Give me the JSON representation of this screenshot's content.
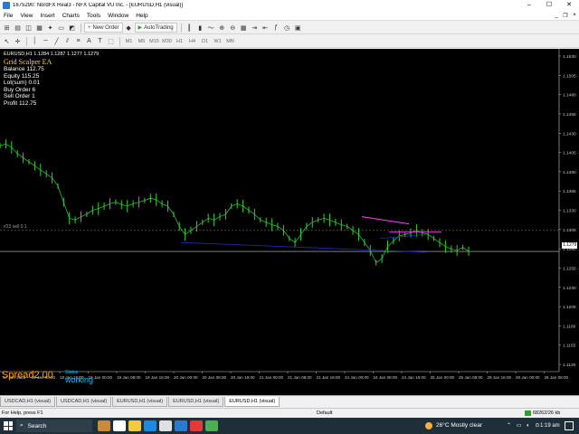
{
  "window": {
    "title": "1675290: NordFX Real3 - NFX Capital VU Inc. - [EURUSD,H1 (visual)]",
    "minimize": "–",
    "maximize": "☐",
    "close": "✕"
  },
  "menu": [
    "File",
    "View",
    "Insert",
    "Charts",
    "Tools",
    "Window",
    "Help"
  ],
  "toolbar": {
    "new_order": "New Order",
    "autotrading": "AutoTrading",
    "timeframes": [
      "M1",
      "M5",
      "M15",
      "M30",
      "H1",
      "H4",
      "D1",
      "W1",
      "MN"
    ]
  },
  "chart": {
    "symbol_label": "EURUSD,H1  1.1284 1.1287 1.1277 1.1279",
    "ea_name": "Grid Scalper EA",
    "stats": [
      {
        "label": "Balance",
        "value": "112.75"
      },
      {
        "label": "Equity",
        "value": "115.25"
      },
      {
        "label": "Lot(sum)",
        "value": "0.01"
      },
      {
        "label": "Buy Order",
        "value": "6"
      },
      {
        "label": "Sell Order",
        "value": "1"
      },
      {
        "label": "Profit",
        "value": "112.75"
      }
    ],
    "level_label": "#23 sell 0.1",
    "current_price": "1.1279",
    "spread_label": "Spread",
    "spread_value": "2.00",
    "status_label": "Status",
    "status_value": "working",
    "colors": {
      "candles": "#33cc33",
      "spread": "#ffa500",
      "status": "#00bfff",
      "trend_line": "#ff44ff"
    }
  },
  "chart_data": {
    "type": "line",
    "symbol": "EURUSD",
    "timeframe": "H1",
    "y_ticks": [
      "1.1530",
      "1.1505",
      "1.1480",
      "1.1455",
      "1.1430",
      "1.1405",
      "1.1380",
      "1.1355",
      "1.1330",
      "1.1305",
      "1.1280",
      "1.1255",
      "1.1230",
      "1.1205",
      "1.1180",
      "1.1155",
      "1.1130"
    ],
    "x_ticks": [
      "17 Jan 2022",
      "18 Jan 08:00",
      "18 Jan 16:00",
      "19 Jan 00:00",
      "19 Jan 08:00",
      "19 Jan 16:00",
      "20 Jan 00:00",
      "20 Jan 08:00",
      "20 Jan 16:00",
      "21 Jan 00:00",
      "21 Jan 08:00",
      "21 Jan 16:00",
      "24 Jan 00:00",
      "24 Jan 08:00",
      "24 Jan 16:00",
      "25 Jan 00:00",
      "25 Jan 08:00",
      "25 Jan 16:00",
      "26 Jan 00:00",
      "26 Jan 08:00"
    ],
    "ylim": [
      1.113,
      1.153
    ],
    "price_path": [
      1.141,
      1.1412,
      1.1408,
      1.14,
      1.1395,
      1.139,
      1.1385,
      1.138,
      1.1375,
      1.137,
      1.136,
      1.134,
      1.132,
      1.1318,
      1.1322,
      1.1325,
      1.133,
      1.1332,
      1.1335,
      1.1338,
      1.134,
      1.1337,
      1.1335,
      1.1338,
      1.134,
      1.1342,
      1.1345,
      1.1343,
      1.1338,
      1.1335,
      1.1325,
      1.131,
      1.13,
      1.1305,
      1.131,
      1.1315,
      1.132,
      1.1318,
      1.1322,
      1.1325,
      1.1335,
      1.1338,
      1.1335,
      1.133,
      1.1325,
      1.1318,
      1.1315,
      1.1312,
      1.131,
      1.1305,
      1.1295,
      1.129,
      1.13,
      1.131,
      1.1315,
      1.1318,
      1.132,
      1.1318,
      1.1315,
      1.1312,
      1.131,
      1.1305,
      1.13,
      1.129,
      1.128,
      1.1265,
      1.127,
      1.1285,
      1.1292,
      1.1298,
      1.13,
      1.1302,
      1.1305,
      1.1302,
      1.13,
      1.1295,
      1.129,
      1.1285,
      1.1282,
      1.128,
      1.1284,
      1.1279
    ],
    "levels": [
      1.1305,
      1.1279
    ],
    "grid": false
  },
  "tabs": [
    "USDCAD,H1 (visual)",
    "USDCAD,H1 (visual)",
    "EURUSD,H1 (visual)",
    "EURUSD,H1 (visual)",
    "EURUSD,H1 (visual)"
  ],
  "active_tab": 4,
  "status": {
    "help": "For Help, press F1",
    "profile": "Default",
    "traffic": "68262/26 kb"
  },
  "taskbar": {
    "search": "Search",
    "weather": "26°C  Mostly clear",
    "time": "1:19 am"
  }
}
